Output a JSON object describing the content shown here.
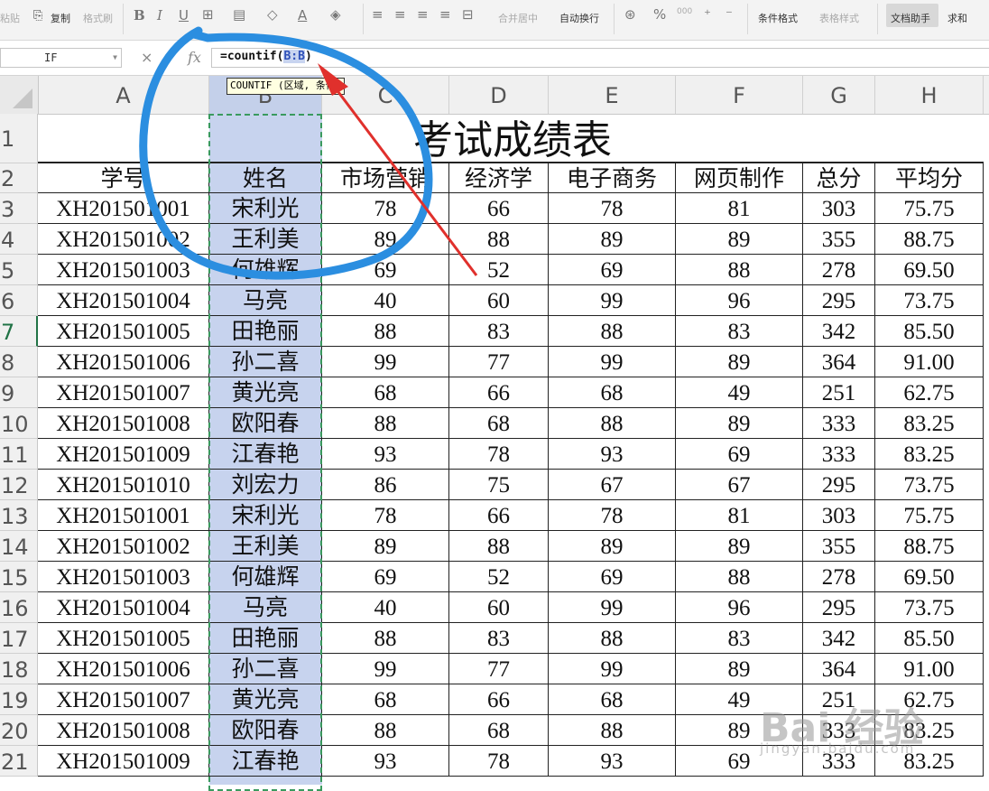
{
  "ribbon": {
    "paste": "粘贴",
    "copy": "复制",
    "format_painter": "格式刷",
    "merge_center": "合并居中",
    "wrap_text": "自动换行",
    "percent": "%",
    "thousands": "000",
    "cond_format": "条件格式",
    "table_style": "表格样式",
    "doc_helper": "文档助手",
    "sum": "求和"
  },
  "formula_bar": {
    "name_box": "IF",
    "cancel": "×",
    "confirm": "✓",
    "fx": "fx",
    "formula_prefix": "=countif(",
    "formula_ref": "B:B",
    "formula_suffix": ")",
    "tooltip": "COUNTIF (区域, 条件)"
  },
  "columns": [
    "A",
    "B",
    "C",
    "D",
    "E",
    "F",
    "G",
    "H"
  ],
  "rows": [
    "1",
    "2",
    "3",
    "4",
    "5",
    "6",
    "7",
    "8",
    "9",
    "10",
    "11",
    "12",
    "13",
    "14",
    "15",
    "16",
    "17",
    "18",
    "19",
    "20",
    "21"
  ],
  "sheet": {
    "title": "考试成绩表",
    "headers": [
      "学号",
      "姓名",
      "市场营销",
      "经济学",
      "电子商务",
      "网页制作",
      "总分",
      "平均分"
    ],
    "data": [
      [
        "XH201501001",
        "宋利光",
        "78",
        "66",
        "78",
        "81",
        "303",
        "75.75"
      ],
      [
        "XH201501002",
        "王利美",
        "89",
        "88",
        "89",
        "89",
        "355",
        "88.75"
      ],
      [
        "XH201501003",
        "何雄辉",
        "69",
        "52",
        "69",
        "88",
        "278",
        "69.50"
      ],
      [
        "XH201501004",
        "马亮",
        "40",
        "60",
        "99",
        "96",
        "295",
        "73.75"
      ],
      [
        "XH201501005",
        "田艳丽",
        "88",
        "83",
        "88",
        "83",
        "342",
        "85.50"
      ],
      [
        "XH201501006",
        "孙二喜",
        "99",
        "77",
        "99",
        "89",
        "364",
        "91.00"
      ],
      [
        "XH201501007",
        "黄光亮",
        "68",
        "66",
        "68",
        "49",
        "251",
        "62.75"
      ],
      [
        "XH201501008",
        "欧阳春",
        "88",
        "68",
        "88",
        "89",
        "333",
        "83.25"
      ],
      [
        "XH201501009",
        "江春艳",
        "93",
        "78",
        "93",
        "69",
        "333",
        "83.25"
      ],
      [
        "XH201501010",
        "刘宏力",
        "86",
        "75",
        "67",
        "67",
        "295",
        "73.75"
      ],
      [
        "XH201501001",
        "宋利光",
        "78",
        "66",
        "78",
        "81",
        "303",
        "75.75"
      ],
      [
        "XH201501002",
        "王利美",
        "89",
        "88",
        "89",
        "89",
        "355",
        "88.75"
      ],
      [
        "XH201501003",
        "何雄辉",
        "69",
        "52",
        "69",
        "88",
        "278",
        "69.50"
      ],
      [
        "XH201501004",
        "马亮",
        "40",
        "60",
        "99",
        "96",
        "295",
        "73.75"
      ],
      [
        "XH201501005",
        "田艳丽",
        "88",
        "83",
        "88",
        "83",
        "342",
        "85.50"
      ],
      [
        "XH201501006",
        "孙二喜",
        "99",
        "77",
        "99",
        "89",
        "364",
        "91.00"
      ],
      [
        "XH201501007",
        "黄光亮",
        "68",
        "66",
        "68",
        "49",
        "251",
        "62.75"
      ],
      [
        "XH201501008",
        "欧阳春",
        "88",
        "68",
        "88",
        "89",
        "333",
        "83.25"
      ],
      [
        "XH201501009",
        "江春艳",
        "93",
        "78",
        "93",
        "69",
        "333",
        "83.25"
      ]
    ]
  },
  "watermark": {
    "brand": "Bai 经验",
    "url": "jingyan.baidu.com"
  },
  "colors": {
    "selection": "#c7d3ee",
    "annotation_circle": "#2b8ee0",
    "annotation_arrow": "#e0302c",
    "marching_ants": "#3a9a5e"
  }
}
